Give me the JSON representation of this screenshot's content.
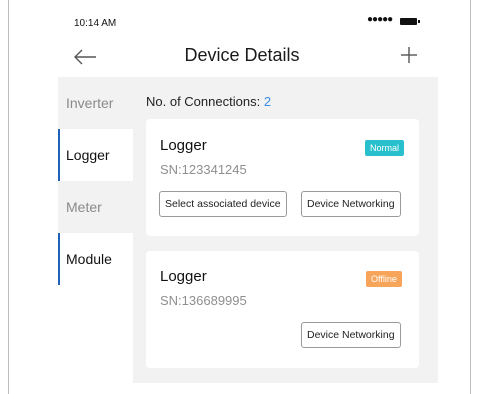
{
  "status_bar": {
    "time": "10:14 AM",
    "signal": "●●●●●"
  },
  "header": {
    "title": "Device Details"
  },
  "sidebar": {
    "items": [
      {
        "label": "Inverter"
      },
      {
        "label": "Logger"
      },
      {
        "label": "Meter"
      },
      {
        "label": "Module"
      }
    ],
    "active": "Logger"
  },
  "main": {
    "connections_label": "No. of Connections:",
    "connections_count": "2",
    "cards": [
      {
        "title": "Logger",
        "sn": "SN:123341245",
        "status": "Normal",
        "buttons": [
          "Select associated device",
          "Device Networking"
        ]
      },
      {
        "title": "Logger",
        "sn": "SN:136689995",
        "status": "Offline",
        "buttons": [
          "Device Networking"
        ]
      }
    ]
  },
  "colors": {
    "accent": "#3a8ee6",
    "normal": "#27c0cc",
    "offline": "#f7a55a",
    "active_indicator": "#1f63b8"
  },
  "icons": [
    "back-arrow-icon",
    "plus-icon",
    "battery-icon"
  ]
}
